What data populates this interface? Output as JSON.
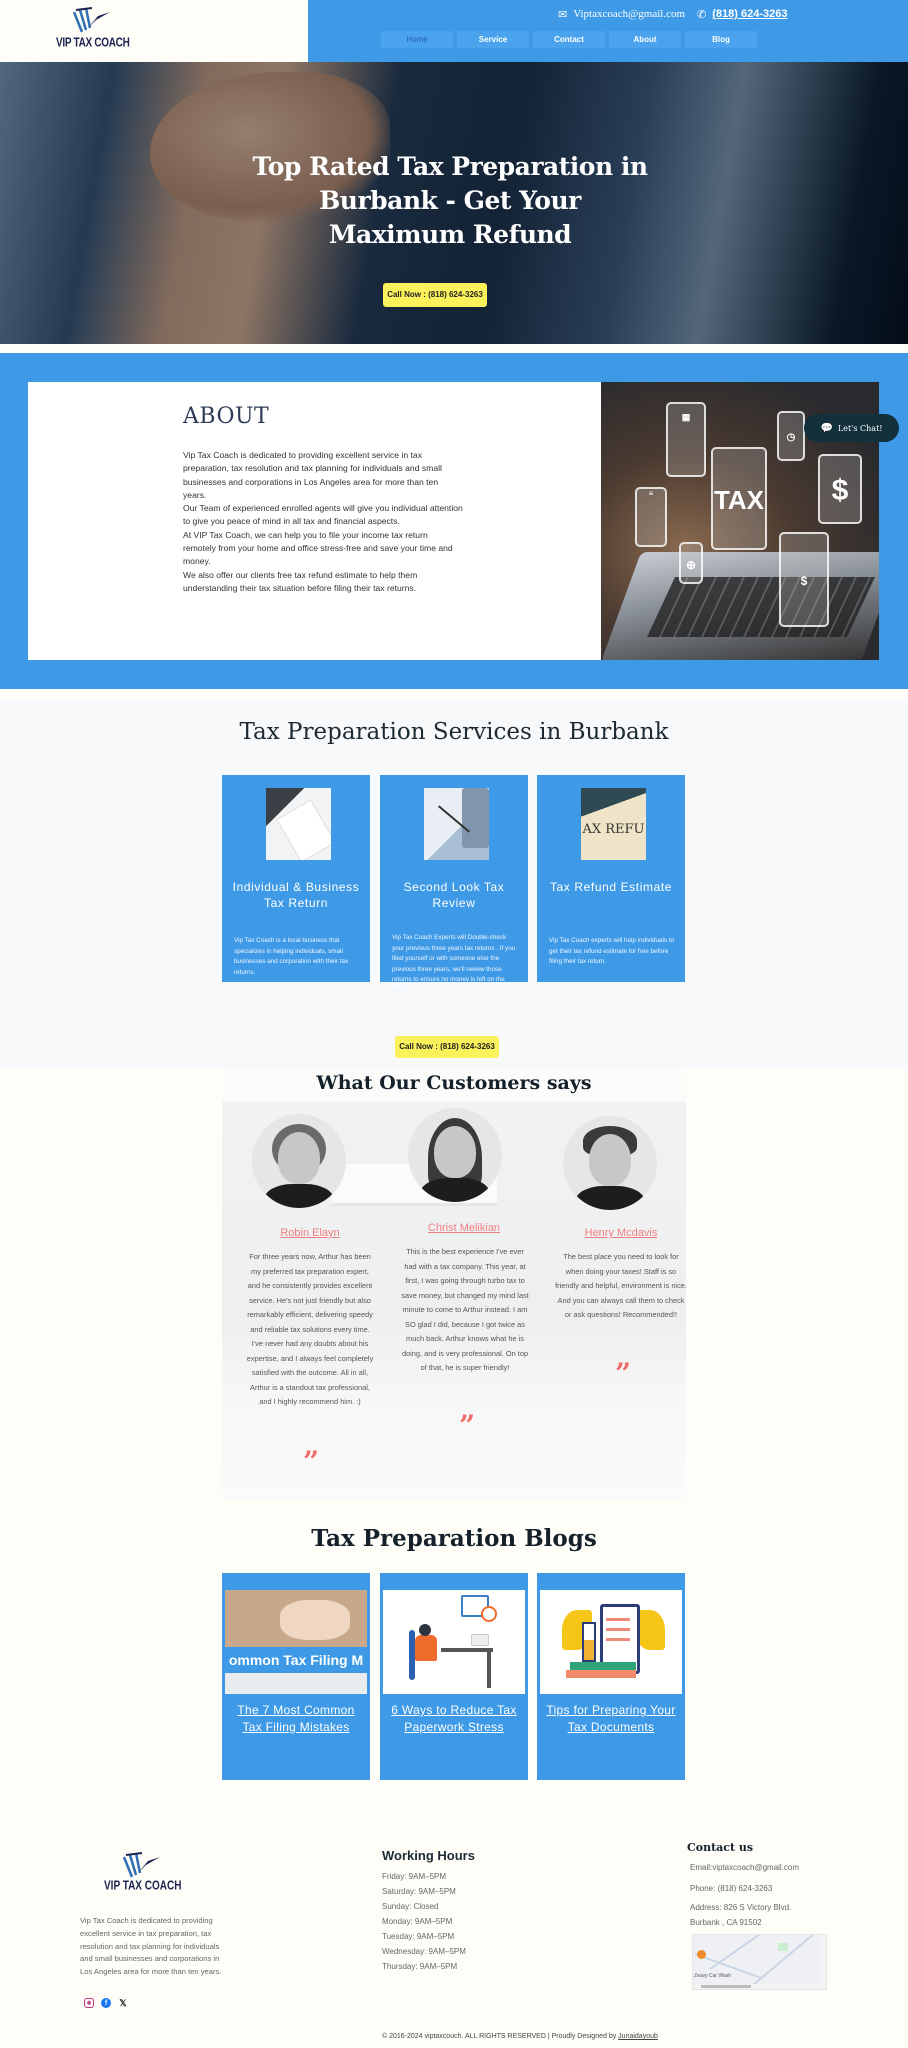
{
  "header": {
    "logo_text": "VIP TAX COACH",
    "email": "Viptaxcoach@gmail.com",
    "phone": "(818) 624-3263",
    "nav": [
      {
        "label": "Home",
        "active": true
      },
      {
        "label": "Service",
        "active": false
      },
      {
        "label": "Contact",
        "active": false
      },
      {
        "label": "About",
        "active": false
      },
      {
        "label": "Blog",
        "active": false
      }
    ]
  },
  "hero": {
    "title": "Top Rated Tax Preparation in Burbank - Get Your Maximum Refund",
    "cta_label": "Call Now : (818) 624-3263"
  },
  "about": {
    "title": "ABOUT",
    "paragraphs": [
      "Vip Tax Coach is dedicated to providing excellent service in tax preparation, tax resolution and tax planning for individuals and small businesses and corporations in Los Angeles area for more than ten years.",
      "Our Team of experienced enrolled agents will give you individual attention to give you peace of mind in all tax and financial aspects.",
      "At VIP Tax Coach, we can help you to file your income tax return remotely from your home and office stress-free and save your time and money.",
      "We also offer our clients free tax refund estimate to help them understanding their tax situation before filing their tax returns."
    ],
    "image_tiles": [
      "TAX",
      "$"
    ]
  },
  "chat": {
    "label": "Let's Chat!"
  },
  "services": {
    "title": "Tax Preparation Services in Burbank",
    "cards": [
      {
        "title": "Individual & Business Tax Return",
        "description": "Vip Tax Coach is a  local business that specializes in helping individuals, small businesses and corporation with their tax returns."
      },
      {
        "title": "Second Look Tax Review",
        "description": "Vip Tax Coach Experts will Double-check your previous three years  tax returns .  If you filed yourself or with someone else the previous three years, we'll review those returns to ensure no money is left on the table."
      },
      {
        "title": "Tax Refund Estimate",
        "description": "Vip Tax Coach experts will help individuals to get their tax refund estimate for free before filing their tax return."
      }
    ],
    "cta_label": "Call Now : (818) 624-3263"
  },
  "testimonials": {
    "title": "What Our Customers says",
    "items": [
      {
        "name": "Robin Elayn",
        "text": "For three years now, Arthur has been my preferred tax preparation expert, and he consistently provides excellent service. He's not just friendly but also remarkably efficient, delivering speedy and reliable tax solutions every time. I've never had any doubts about his expertise, and I always feel completely satisfied with the outcome. All in all, Arthur is a standout tax professional, and I highly recommend him. :)"
      },
      {
        "name": "Christ Melikian",
        "text": "This is the best experience I've ever had with a tax company. This year, at first, I was going through turbo tax to save money, but changed my mind last minute to come to Arthur instead. I am SO glad I did, because I got twice as much back. Arthur knows what he is doing, and is very professional. On top of that, he is super friendly!"
      },
      {
        "name": "Henry Mcdavis",
        "text": "The best place you need to look for when doing your taxes! Staff is so friendly and helpful, environment is nice. And you can always call them to check or ask questions! Recommended!!"
      }
    ],
    "quote_glyph": "”"
  },
  "blogs": {
    "title": "Tax Preparation Blogs",
    "posts": [
      {
        "title": "The 7 Most Common Tax Filing Mistakes",
        "image_caption": "ommon Tax Filing M"
      },
      {
        "title": "6 Ways to Reduce Tax Paperwork Stress"
      },
      {
        "title": "Tips for Preparing Your Tax Documents"
      }
    ]
  },
  "footer": {
    "logo_text": "VIP TAX COACH",
    "about": "Vip Tax Coach is dedicated to providing excellent service in tax preparation, tax resolution and tax planning for individuals and small businesses and corporations in Los Angeles area for more than ten years.",
    "social": [
      {
        "icon": "instagram-icon",
        "glyph": "◎"
      },
      {
        "icon": "facebook-icon",
        "glyph": "f"
      },
      {
        "icon": "x-icon",
        "glyph": "𝕏"
      }
    ],
    "hours_title": "Working Hours",
    "hours": [
      "Friday: 9AM–5PM",
      "Saturday: 9AM–5PM",
      "Sunday: Closed",
      "Monday: 9AM–5PM",
      "Tuesday: 9AM–5PM",
      "Wednesday: 9AM–5PM",
      "Thursday: 9AM–5PM"
    ],
    "contact_title": "Contact us",
    "email_line": "Email:viptaxcoach@gmail.com",
    "phone_line": "Phone: (818) 624-3263",
    "address_line1": "Address: 826 S Victory Blvd.",
    "address_line2": "Burbank , CA 91502",
    "map_label": "Zeavy Car Wash",
    "copyright": "© 2016-2024 viptaxcouch. ALL RIGHTS RESERVED | Proudly Designed by",
    "designer": "Junaidayoub"
  },
  "colors": {
    "primary_blue": "#3e9ae6",
    "cta_yellow": "#fbf15b",
    "accent_coral": "#f07f7f",
    "dark_navy": "#1c2350"
  }
}
